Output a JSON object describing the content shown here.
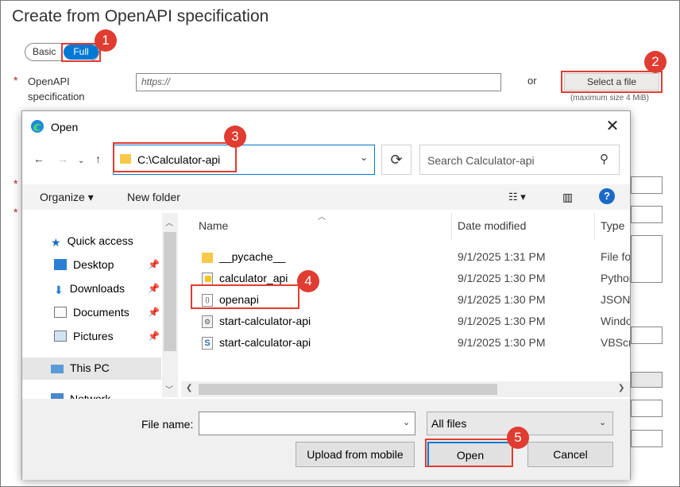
{
  "page": {
    "title": "Create from OpenAPI specification",
    "mode_toggle": {
      "basic_label": "Basic",
      "full_label": "Full"
    },
    "openapi_label": "OpenAPI specification",
    "required_mark": "*",
    "url_placeholder": "https://",
    "or_label": "or",
    "select_file_label": "Select a file",
    "max_size_note": "(maximum size 4 MiB)"
  },
  "callouts": [
    "1",
    "2",
    "3",
    "4",
    "5"
  ],
  "dialog": {
    "title": "Open",
    "close_icon": "✕",
    "address_path": "C:\\Calculator-api",
    "search_placeholder": "Search Calculator-api",
    "commands": {
      "organize_label": "Organize ▾",
      "new_folder_label": "New folder"
    },
    "nav": {
      "items": [
        {
          "label": "Quick access",
          "icon": "star-icon"
        },
        {
          "label": "Desktop",
          "icon": "desktop-icon",
          "pinned": true
        },
        {
          "label": "Downloads",
          "icon": "download-icon",
          "pinned": true
        },
        {
          "label": "Documents",
          "icon": "documents-icon",
          "pinned": true
        },
        {
          "label": "Pictures",
          "icon": "pictures-icon",
          "pinned": true
        },
        {
          "label": "This PC",
          "icon": "computer-icon",
          "selected": true
        },
        {
          "label": "Network",
          "icon": "network-icon"
        }
      ]
    },
    "columns": {
      "name": "Name",
      "date": "Date modified",
      "type": "Type"
    },
    "files": [
      {
        "name": "__pycache__",
        "date": "9/1/2025 1:31 PM",
        "type": "File folder",
        "icon": "folder-icon"
      },
      {
        "name": "calculator_api",
        "date": "9/1/2025 1:30 PM",
        "type": "Python File",
        "icon": "python-file-icon"
      },
      {
        "name": "openapi",
        "date": "9/1/2025 1:30 PM",
        "type": "JSON File",
        "icon": "json-file-icon"
      },
      {
        "name": "start-calculator-api",
        "date": "9/1/2025 1:30 PM",
        "type": "Windows Batch File",
        "icon": "batch-file-icon"
      },
      {
        "name": "start-calculator-api",
        "date": "9/1/2025 1:30 PM",
        "type": "VBScript Script File",
        "icon": "vbscript-file-icon"
      }
    ],
    "file_name_label": "File name:",
    "file_name_value": "",
    "file_type_value": "All files",
    "buttons": {
      "upload_label": "Upload from mobile",
      "open_label": "Open",
      "cancel_label": "Cancel"
    }
  },
  "colors": {
    "accent": "#0078d4",
    "callout": "#e03c31",
    "required": "#a4262c"
  }
}
